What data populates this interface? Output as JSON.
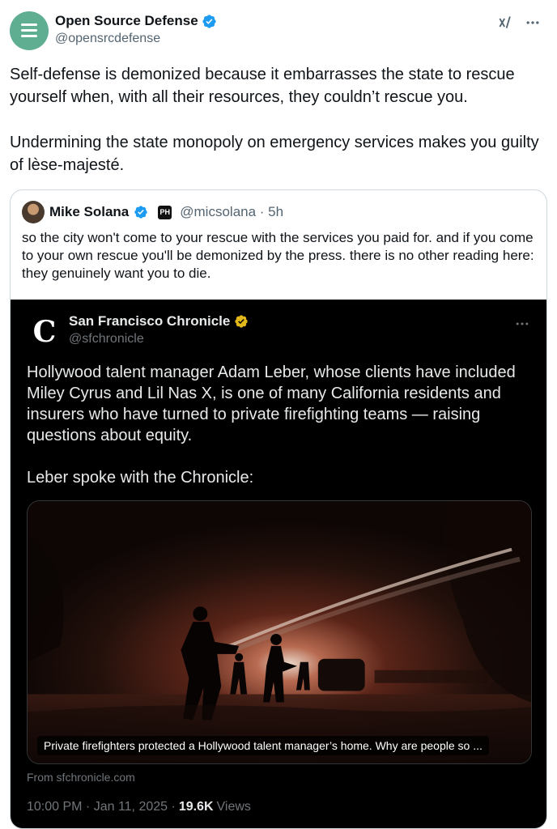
{
  "post": {
    "author_name": "Open Source Defense",
    "author_handle": "@opensrcdefense",
    "text_p1": "Self-defense is demonized because it embarrasses the state to rescue yourself when, with all their resources, they couldn’t rescue you.",
    "text_p2": "Undermining the state monopoly on emergency services makes you guilty of lèse-majesté.",
    "icons": {
      "avatar": "hamburger-logo",
      "verified": "blue-check-icon",
      "grok": "grok-icon",
      "more": "more-dots-icon"
    }
  },
  "quote": {
    "author_name": "Mike Solana",
    "badge_label": "PH",
    "handle_time": "@micsolana · 5h",
    "text": "so the city won't come to your rescue with the services you paid for. and if you come to your own rescue you'll be demonized by the press. there is no other reading here: they genuinely want you to die."
  },
  "embedded": {
    "logo_letter": "C",
    "author_name": "San Francisco Chronicle",
    "author_handle": "@sfchronicle",
    "text_p1": "Hollywood talent manager Adam Leber, whose clients have included Miley Cyrus and Lil Nas X, is one of many California residents and insurers who have turned to private firefighting teams — raising questions about equity.",
    "text_p2": "Leber spoke with the Chronicle:",
    "link_caption": "Private firefighters protected a Hollywood talent manager’s home. Why are people so ...",
    "from": "From sfchronicle.com",
    "time": "10:00 PM · Jan 11, 2025 ·",
    "views_count": "19.6K",
    "views_label": "Views"
  },
  "colors": {
    "accent_blue": "#1d9bf0",
    "gold_check": "#e2b719",
    "avatar_green": "#5fae92"
  }
}
